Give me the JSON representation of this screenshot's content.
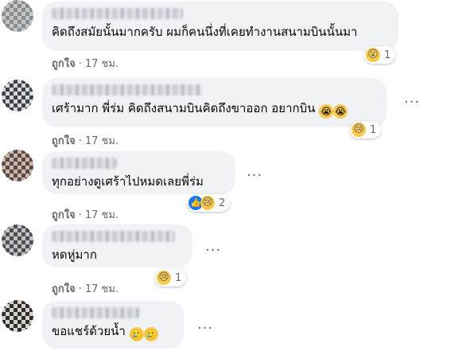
{
  "like_label": "ถูกใจ",
  "separator": "·",
  "time_ago": "17 ชม.",
  "more_icon": "more-options-icon",
  "colors": {
    "bubble": "#f0f2f5",
    "meta": "#65676b",
    "like_blue": "#1877f2",
    "emoji_yellow": "#f7c84a"
  },
  "comments": [
    {
      "text": "คิดถึงสมัยนั้นมากครับ ผมก็คนนึ่งที่เคยทำงานสนามบินนั้นมา",
      "reactions": [
        "wow"
      ],
      "reaction_count": "1"
    },
    {
      "text": "เศร้ามาก พี่ร่ม คิดถึงสนามบินคิดถึงขาออก อยากบิน",
      "inline_emojis": [
        "crying-face-icon",
        "crying-face-icon"
      ],
      "reactions": [
        "sad"
      ],
      "reaction_count": "1"
    },
    {
      "text": "ทุกอย่างดูเศร้าไปหมดเลยพี่ร่ม",
      "reactions": [
        "like",
        "sad"
      ],
      "reaction_count": "2"
    },
    {
      "text": "หดหู่มาก",
      "reactions": [
        "sad"
      ],
      "reaction_count": "1"
    },
    {
      "text": "ขอแชร์ด้วยน้ำ",
      "inline_emojis": [
        "sad-tear-face-icon",
        "sad-tear-face-icon"
      ]
    }
  ]
}
